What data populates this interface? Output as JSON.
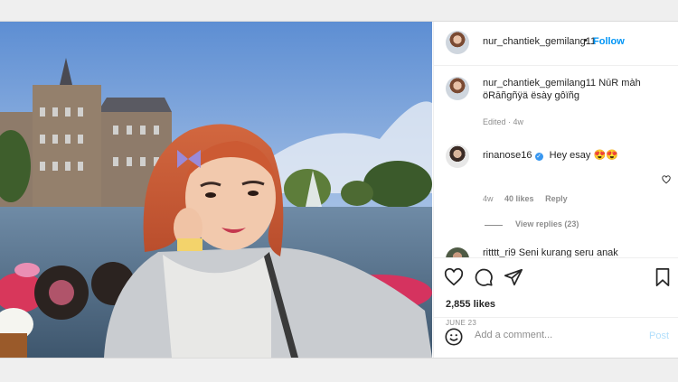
{
  "header": {
    "username": "nur_chantiek_gemilang11",
    "separator": "•",
    "follow": "Follow"
  },
  "caption": {
    "username": "nur_chantiek_gemilang11",
    "text": "NūR màh öRāñgñÿä ësày gôïñg",
    "edited": "Edited · 4w"
  },
  "comment": {
    "username": "rinanose16",
    "verified_icon": "✓",
    "text": "Hey esay 😍😍",
    "age": "4w",
    "likes": "40 likes",
    "reply": "Reply"
  },
  "replies": {
    "label": "View replies (23)"
  },
  "cut_comment": {
    "text": "ritttt_ri9  Seni kurang seru anak"
  },
  "actions": {
    "like_icon": "heart-icon",
    "comment_icon": "speech-bubble-icon",
    "share_icon": "paper-plane-icon",
    "save_icon": "bookmark-icon"
  },
  "likes": "2,855 likes",
  "date": "JUNE 23",
  "add_comment": {
    "placeholder": "Add a comment...",
    "post": "Post"
  },
  "colors": {
    "accent": "#0095f6",
    "verified": "#3897f0",
    "text": "#262626",
    "muted": "#8e8e8e"
  }
}
